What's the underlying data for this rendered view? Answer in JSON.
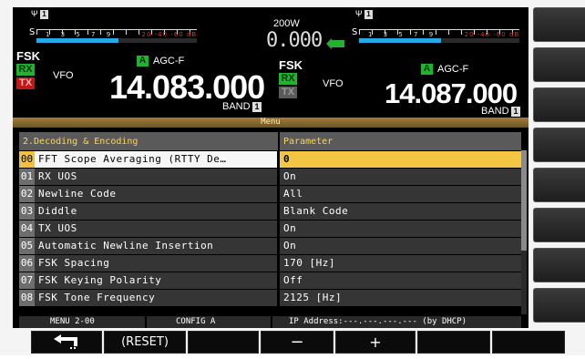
{
  "header": {
    "left": {
      "meter_scale": "1 3 5 7 9",
      "meter_red": "-20 -40 -60 dB",
      "mode": "FSK",
      "rx": "RX",
      "tx": "TX",
      "vfo": "VFO",
      "vfo_letter": "A",
      "agc": "AGC-F",
      "frequency": "14.083.000",
      "band": "BAND",
      "band_number": "1"
    },
    "center": {
      "power": "200W",
      "offset": "0.000"
    },
    "right": {
      "meter_scale": "1 3 5 7 9",
      "meter_red": "-20 -40 -60 dB",
      "mode": "FSK",
      "rx": "RX",
      "tx": "TX",
      "vfo": "VFO",
      "vfo_letter": "A",
      "agc": "AGC-F",
      "frequency": "14.087.000",
      "band": "BAND",
      "band_number": "1"
    },
    "signal_label": "1"
  },
  "menu": {
    "title": "Menu",
    "group": "2.Decoding & Encoding",
    "param_header": "Parameter",
    "items": [
      {
        "num": "00",
        "name": "FFT Scope Averaging (RTTY De…",
        "value": "0",
        "selected": true
      },
      {
        "num": "01",
        "name": "RX UOS",
        "value": "On"
      },
      {
        "num": "02",
        "name": "Newline Code",
        "value": "All"
      },
      {
        "num": "03",
        "name": "Diddle",
        "value": "Blank Code"
      },
      {
        "num": "04",
        "name": "TX UOS",
        "value": "On"
      },
      {
        "num": "05",
        "name": "Automatic Newline Insertion",
        "value": "On"
      },
      {
        "num": "06",
        "name": "FSK Spacing",
        "value": "170 [Hz]"
      },
      {
        "num": "07",
        "name": "FSK Keying Polarity",
        "value": "Off"
      },
      {
        "num": "08",
        "name": "FSK Tone Frequency",
        "value": "2125 [Hz]"
      }
    ]
  },
  "status_bar": {
    "menu": "MENU 2-00",
    "config": "CONFIG A",
    "ip": "IP Address:---.---.---.--- (by DHCP)"
  },
  "function_keys": {
    "back": "back-arrow-icon",
    "reset": "(RESET)",
    "minus": "−",
    "plus": "+"
  },
  "colors": {
    "selected_row": "#f2c542",
    "rx_green": "#21b231",
    "tx_red": "#c01818",
    "meter_blue": "#27a8e8",
    "menu_header_text": "#ffd45a"
  }
}
